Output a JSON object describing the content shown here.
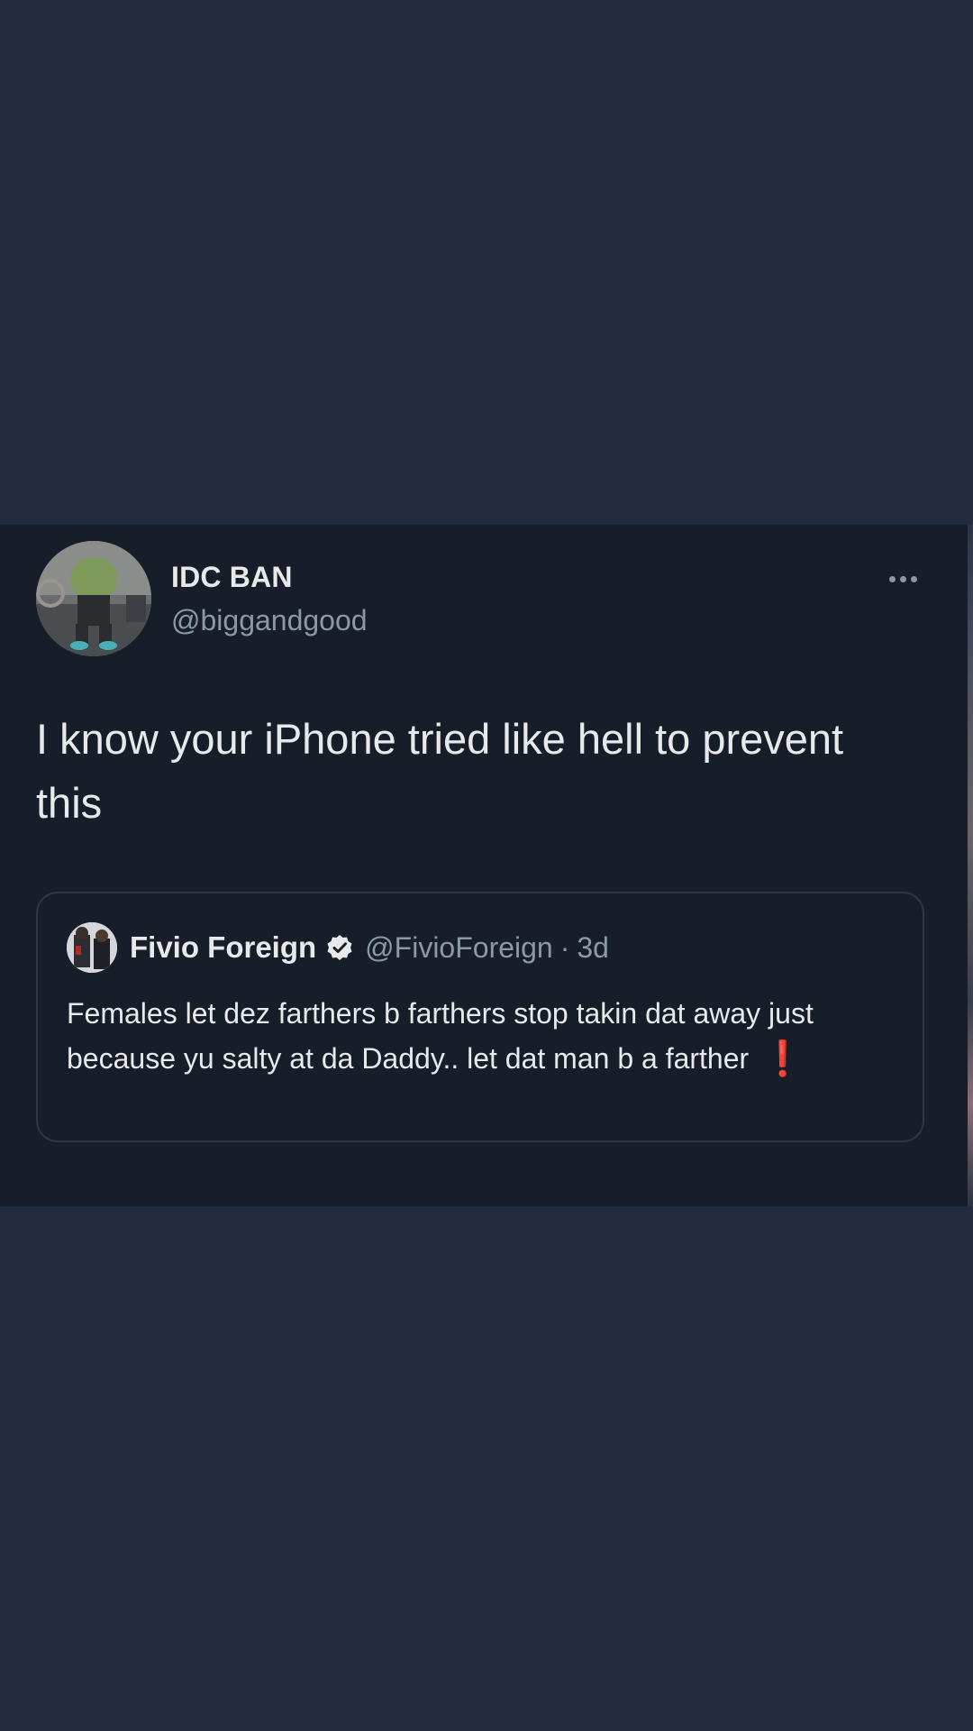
{
  "tweet": {
    "display_name": "IDC BAN",
    "handle": "@biggandgood",
    "text": "I know your iPhone tried like hell to prevent this",
    "more_icon": "more-horizontal-icon"
  },
  "quoted_tweet": {
    "display_name": "Fivio Foreign",
    "verified_icon": "verified-badge-icon",
    "handle": "@FivioForeign",
    "separator": "·",
    "time": "3d",
    "text": "Females let dez farthers b farthers stop takin dat away just because yu salty at da Daddy.. let dat man b a farther",
    "emoji": "❗"
  },
  "colors": {
    "page_background": "#222b40",
    "card_background": "#171e2a",
    "primary_text": "#e7e9ea",
    "secondary_text": "#8b98a5",
    "quote_border": "#2f3642",
    "emoji_red": "#e0242c"
  }
}
